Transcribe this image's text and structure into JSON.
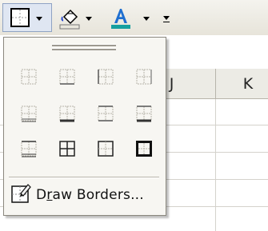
{
  "toolbar": {
    "borders_button": "borders-button",
    "fill_color_button": "fill-color-button",
    "font_color_button": "font-color-button",
    "colors": {
      "fill": "#2244cc",
      "font": "#1f6fd0",
      "font_color_bar": "#16a0a0",
      "fill_color_bar": "#e8e6dc"
    }
  },
  "sheet": {
    "columns": [
      "J",
      "K"
    ]
  },
  "palette": {
    "border_options": [
      "no-border",
      "bottom-border",
      "left-border",
      "right-border",
      "bottom-double-border",
      "thick-bottom-border",
      "top-bottom-border",
      "top-thick-bottom-border",
      "top-double-bottom-border",
      "all-borders",
      "outside-borders",
      "thick-box-border"
    ],
    "draw_borders": {
      "label_prefix": "D",
      "label_underlined": "r",
      "label_rest": "aw Borders..."
    }
  }
}
